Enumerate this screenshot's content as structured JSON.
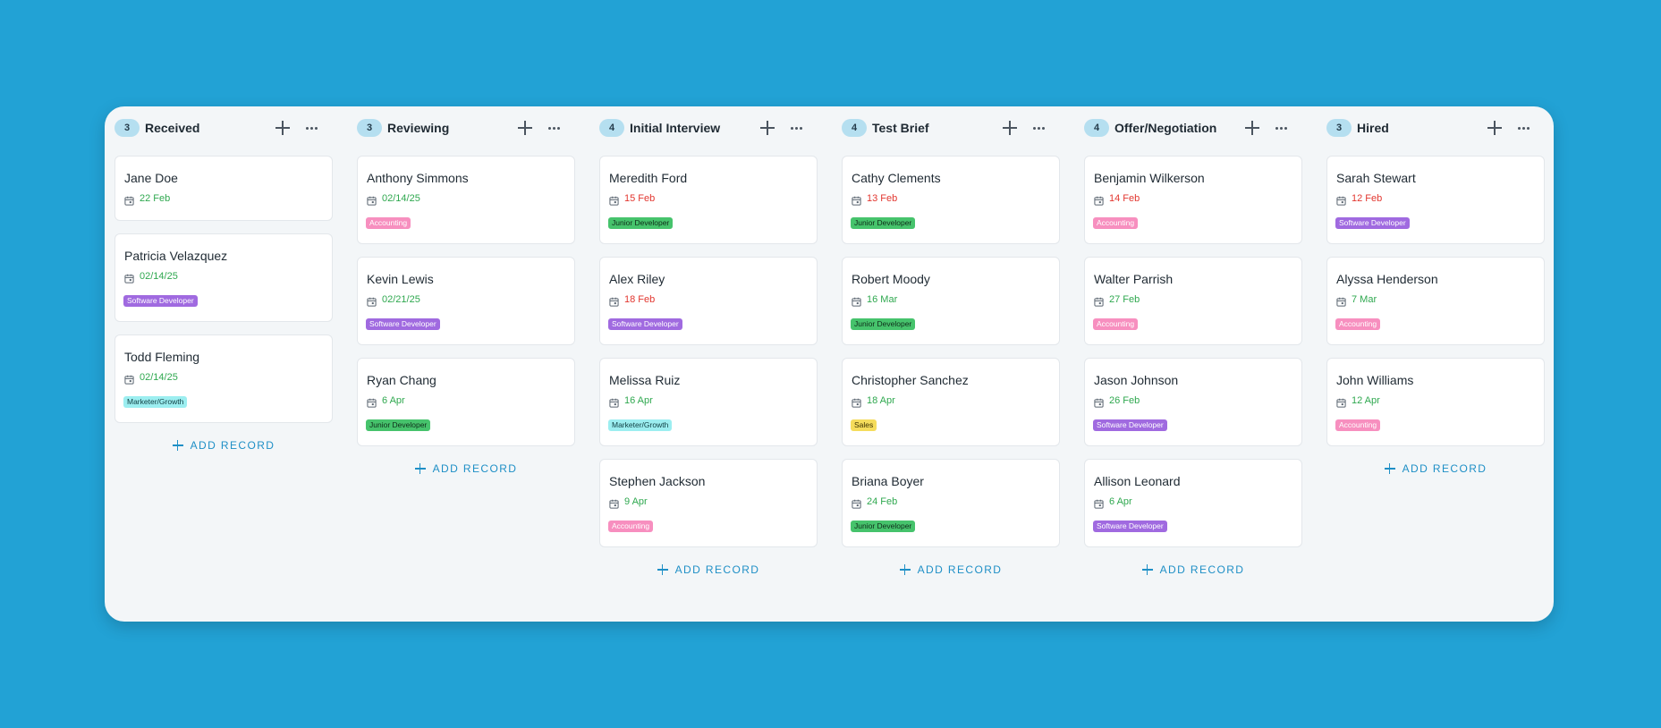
{
  "board": {
    "add_record_label": "ADD RECORD",
    "columns": [
      {
        "title": "Received",
        "count": "3",
        "cards": [
          {
            "name": "Jane Doe",
            "date": "22 Feb",
            "date_status": "ok",
            "tag": ""
          },
          {
            "name": "Patricia Velazquez",
            "date": "02/14/25",
            "date_status": "ok",
            "tag": "Software Developer"
          },
          {
            "name": "Todd Fleming",
            "date": "02/14/25",
            "date_status": "ok",
            "tag": "Marketer/Growth"
          }
        ]
      },
      {
        "title": "Reviewing",
        "count": "3",
        "cards": [
          {
            "name": "Anthony Simmons",
            "date": "02/14/25",
            "date_status": "ok",
            "tag": "Accounting"
          },
          {
            "name": "Kevin Lewis",
            "date": "02/21/25",
            "date_status": "ok",
            "tag": "Software Developer"
          },
          {
            "name": "Ryan Chang",
            "date": "6 Apr",
            "date_status": "ok",
            "tag": "Junior Developer"
          }
        ]
      },
      {
        "title": "Initial Interview",
        "count": "4",
        "cards": [
          {
            "name": "Meredith Ford",
            "date": "15 Feb",
            "date_status": "overdue",
            "tag": "Junior Developer"
          },
          {
            "name": "Alex Riley",
            "date": "18 Feb",
            "date_status": "overdue",
            "tag": "Software Developer"
          },
          {
            "name": "Melissa Ruiz",
            "date": "16 Apr",
            "date_status": "ok",
            "tag": "Marketer/Growth"
          },
          {
            "name": "Stephen Jackson",
            "date": "9 Apr",
            "date_status": "ok",
            "tag": "Accounting"
          }
        ]
      },
      {
        "title": "Test Brief",
        "count": "4",
        "cards": [
          {
            "name": "Cathy Clements",
            "date": "13 Feb",
            "date_status": "overdue",
            "tag": "Junior Developer"
          },
          {
            "name": "Robert Moody",
            "date": "16 Mar",
            "date_status": "ok",
            "tag": "Junior Developer"
          },
          {
            "name": "Christopher Sanchez",
            "date": "18 Apr",
            "date_status": "ok",
            "tag": "Sales"
          },
          {
            "name": "Briana Boyer",
            "date": "24 Feb",
            "date_status": "ok",
            "tag": "Junior Developer"
          }
        ]
      },
      {
        "title": "Offer/Negotiation",
        "count": "4",
        "cards": [
          {
            "name": "Benjamin Wilkerson",
            "date": "14 Feb",
            "date_status": "overdue",
            "tag": "Accounting"
          },
          {
            "name": "Walter Parrish",
            "date": "27 Feb",
            "date_status": "ok",
            "tag": "Accounting"
          },
          {
            "name": "Jason Johnson",
            "date": "26 Feb",
            "date_status": "ok",
            "tag": "Software Developer"
          },
          {
            "name": "Allison Leonard",
            "date": "6 Apr",
            "date_status": "ok",
            "tag": "Software Developer"
          }
        ]
      },
      {
        "title": "Hired",
        "count": "3",
        "cards": [
          {
            "name": "Sarah Stewart",
            "date": "12 Feb",
            "date_status": "overdue",
            "tag": "Software Developer"
          },
          {
            "name": "Alyssa Henderson",
            "date": "7 Mar",
            "date_status": "ok",
            "tag": "Accounting"
          },
          {
            "name": "John Williams",
            "date": "12 Apr",
            "date_status": "ok",
            "tag": "Accounting"
          }
        ]
      }
    ]
  },
  "colors": {
    "background": "#22a2d5",
    "board": "#f3f6f8",
    "accent": "#1e8fc6",
    "date_ok": "#2fa84f",
    "date_overdue": "#e2362f"
  },
  "tag_styles": {
    "Accounting": {
      "bg": "#f78fbf",
      "fg": "#ffffff"
    },
    "Software Developer": {
      "bg": "#a06ae0",
      "fg": "#ffffff"
    },
    "Junior Developer": {
      "bg": "#46c36c",
      "fg": "#0f2d1a"
    },
    "Marketer/Growth": {
      "bg": "#9ceef0",
      "fg": "#114044"
    },
    "Sales": {
      "bg": "#f5dc5c",
      "fg": "#3b3100"
    }
  }
}
